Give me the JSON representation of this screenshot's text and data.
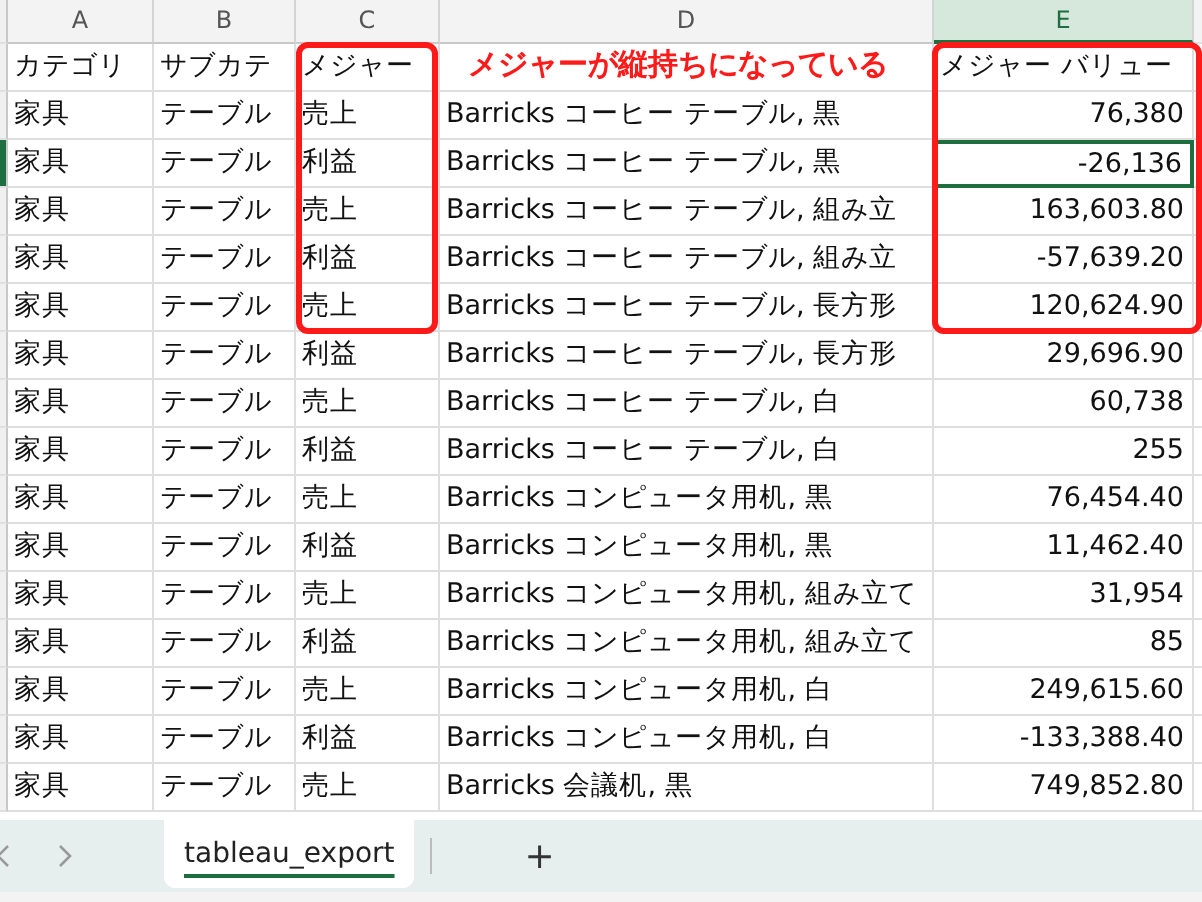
{
  "column_letters": [
    {
      "label": "A",
      "selected": false
    },
    {
      "label": "B",
      "selected": false
    },
    {
      "label": "C",
      "selected": false
    },
    {
      "label": "D",
      "selected": false
    },
    {
      "label": "E",
      "selected": true
    }
  ],
  "header_row": {
    "category": "カテゴリ",
    "subcategory": "サブカテ",
    "measure": "メジャー",
    "value": "メジャー バリュー"
  },
  "rows": [
    {
      "category": "家具",
      "subcategory": "テーブル",
      "measure": "売上",
      "product": "Barricks コーヒー テーブル, 黒",
      "value": "76,380",
      "selected": false
    },
    {
      "category": "家具",
      "subcategory": "テーブル",
      "measure": "利益",
      "product": "Barricks コーヒー テーブル, 黒",
      "value": "-26,136",
      "selected": true
    },
    {
      "category": "家具",
      "subcategory": "テーブル",
      "measure": "売上",
      "product": "Barricks コーヒー テーブル, 組み立",
      "value": "163,603.80",
      "selected": false
    },
    {
      "category": "家具",
      "subcategory": "テーブル",
      "measure": "利益",
      "product": "Barricks コーヒー テーブル, 組み立",
      "value": "-57,639.20",
      "selected": false
    },
    {
      "category": "家具",
      "subcategory": "テーブル",
      "measure": "売上",
      "product": "Barricks コーヒー テーブル, 長方形",
      "value": "120,624.90",
      "selected": false
    },
    {
      "category": "家具",
      "subcategory": "テーブル",
      "measure": "利益",
      "product": "Barricks コーヒー テーブル, 長方形",
      "value": "29,696.90",
      "selected": false
    },
    {
      "category": "家具",
      "subcategory": "テーブル",
      "measure": "売上",
      "product": "Barricks コーヒー テーブル, 白",
      "value": "60,738",
      "selected": false
    },
    {
      "category": "家具",
      "subcategory": "テーブル",
      "measure": "利益",
      "product": "Barricks コーヒー テーブル, 白",
      "value": "255",
      "selected": false
    },
    {
      "category": "家具",
      "subcategory": "テーブル",
      "measure": "売上",
      "product": "Barricks コンピュータ用机, 黒",
      "value": "76,454.40",
      "selected": false
    },
    {
      "category": "家具",
      "subcategory": "テーブル",
      "measure": "利益",
      "product": "Barricks コンピュータ用机, 黒",
      "value": "11,462.40",
      "selected": false
    },
    {
      "category": "家具",
      "subcategory": "テーブル",
      "measure": "売上",
      "product": "Barricks コンピュータ用机, 組み立て",
      "value": "31,954",
      "selected": false
    },
    {
      "category": "家具",
      "subcategory": "テーブル",
      "measure": "利益",
      "product": "Barricks コンピュータ用机, 組み立て",
      "value": "85",
      "selected": false
    },
    {
      "category": "家具",
      "subcategory": "テーブル",
      "measure": "売上",
      "product": "Barricks コンピュータ用机, 白",
      "value": "249,615.60",
      "selected": false
    },
    {
      "category": "家具",
      "subcategory": "テーブル",
      "measure": "利益",
      "product": "Barricks コンピュータ用机, 白",
      "value": "-133,388.40",
      "selected": false
    },
    {
      "category": "家具",
      "subcategory": "テーブル",
      "measure": "売上",
      "product": "Barricks 会議机, 黒",
      "value": "749,852.80",
      "selected": false
    }
  ],
  "annotation": {
    "callout": "メジャーが縦持ちになっている"
  },
  "sheet_tabs": [
    {
      "label": "tableau_export",
      "selected": true
    }
  ],
  "add_sheet": "+"
}
